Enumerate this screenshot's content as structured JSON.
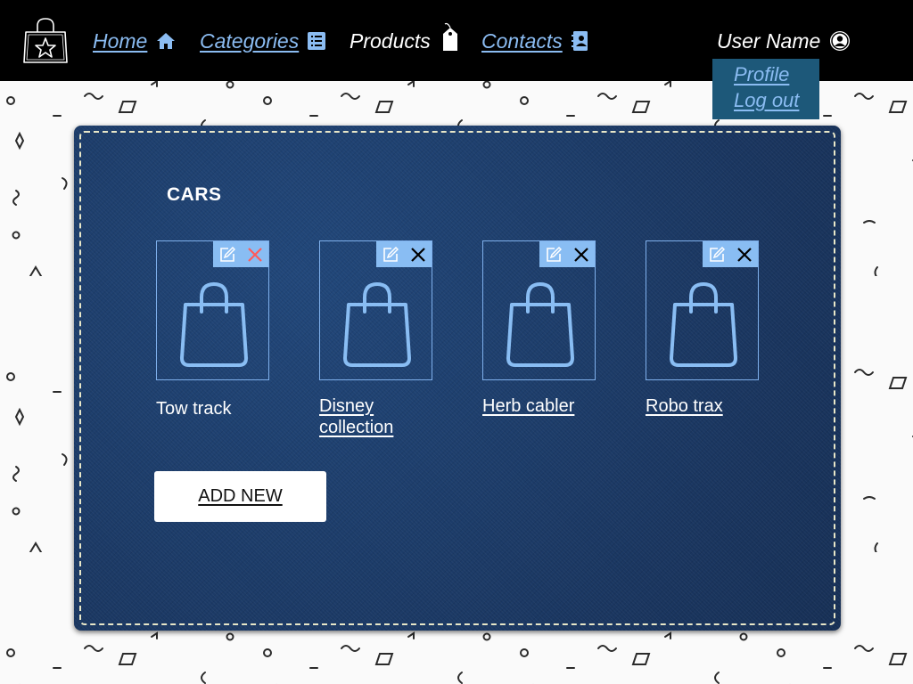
{
  "nav": {
    "home_label": "Home",
    "categories_label": "Categories",
    "products_label": "Products",
    "contacts_label": "Contacts",
    "user_name": "User Name"
  },
  "user_dropdown": {
    "profile_label": "Profile",
    "logout_label": "Log out"
  },
  "main": {
    "category_title": "CARS",
    "products": [
      {
        "name": "Tow track",
        "icon": "shopping-bag-icon",
        "delete_color": "#ff5a5a"
      },
      {
        "name": "Disney collection",
        "icon": "shopping-bag-icon",
        "delete_color": "#000000"
      },
      {
        "name": "Herb cabler",
        "icon": "shopping-bag-icon",
        "delete_color": "#000000"
      },
      {
        "name": "Robo trax",
        "icon": "shopping-bag-icon",
        "delete_color": "#000000"
      }
    ],
    "add_new_label": "ADD NEW"
  },
  "colors": {
    "header_bg": "#000000",
    "nav_link": "#8bbcf2",
    "dropdown_bg": "#1d5879",
    "panel_denim": "#1c3a66",
    "card_border": "#7fb0ec",
    "action_bar": "#89bdf3"
  }
}
